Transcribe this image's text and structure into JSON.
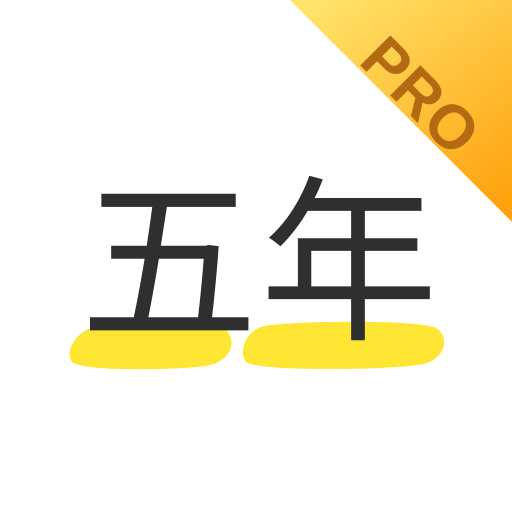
{
  "badge": {
    "label": "PRO",
    "text_color": "#b46a12",
    "gradient_start": "#ffe36a",
    "gradient_end": "#ffa20e"
  },
  "wordmark": {
    "text": "五年",
    "color": "#2f2f2f"
  },
  "highlight": {
    "color": "#ffe634"
  },
  "background": {
    "color": "#ffffff"
  }
}
